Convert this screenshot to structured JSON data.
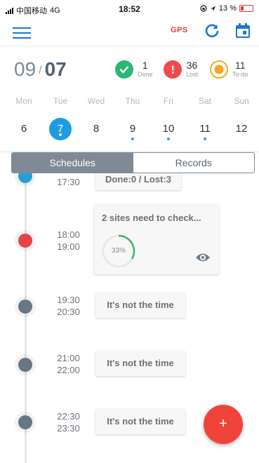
{
  "status_bar": {
    "carrier": "中国移动",
    "network": "4G",
    "time": "18:52",
    "battery": "13 %"
  },
  "app_bar": {
    "gps_label": "GPS"
  },
  "header": {
    "date_month": "09",
    "date_separator": "/",
    "date_day": "07",
    "stats": [
      {
        "value": "1",
        "label": "Done",
        "color": "#2bb673"
      },
      {
        "value": "36",
        "label": "Lost",
        "color": "#f04a4a"
      },
      {
        "value": "11",
        "label": "To-do",
        "color": "#f5a623"
      }
    ]
  },
  "week": {
    "weekdays": [
      "Mon",
      "Tue",
      "Wed",
      "Thu",
      "Fri",
      "Sat",
      "Sun"
    ],
    "dates": [
      "6",
      "7",
      "8",
      "9",
      "10",
      "11",
      "12"
    ],
    "selected": "7",
    "accent": "#1e9be0"
  },
  "tabs": [
    {
      "label": "Schedules",
      "active": true
    },
    {
      "label": "Records",
      "active": false
    }
  ],
  "timeline": [
    {
      "start": "",
      "end": "17:30",
      "node_color": "#29a8e0",
      "card": "Done:0 / Lost:3"
    },
    {
      "start": "18:00",
      "end": "19:00",
      "node_color": "#f04a4a",
      "card": "2 sites need to check...",
      "progress": "33%"
    },
    {
      "start": "19:30",
      "end": "20:30",
      "node_color": "#6d7f8c",
      "card": "It's not the time"
    },
    {
      "start": "21:00",
      "end": "22:00",
      "node_color": "#6d7f8c",
      "card": "It's not the time"
    },
    {
      "start": "22:30",
      "end": "23:30",
      "node_color": "#6d7f8c",
      "card": "It's not the time"
    }
  ],
  "fab": {
    "label": "+",
    "color": "#f0443a"
  }
}
